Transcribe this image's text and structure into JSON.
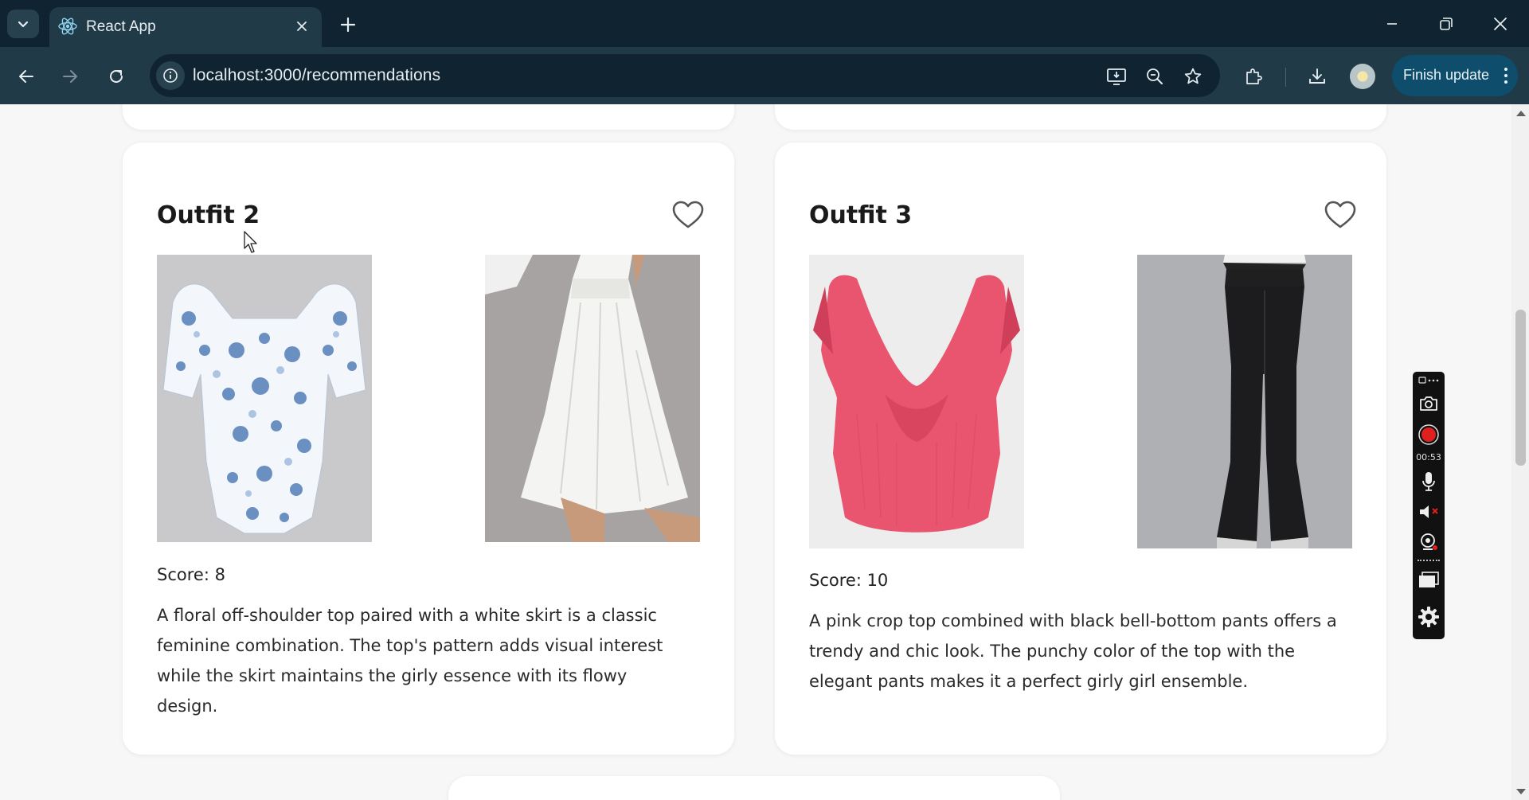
{
  "browser": {
    "tab_title": "React App",
    "url": "localhost:3000/recommendations",
    "finish_update_label": "Finish update"
  },
  "outfits": [
    {
      "title": "Outfit 2",
      "score": "Score: 8",
      "description": "A floral off-shoulder top paired with a white skirt is a classic feminine combination. The top's pattern adds visual interest while the skirt maintains the girly essence with its flowy design.",
      "items": [
        "floral-blue-top",
        "white-skirt"
      ]
    },
    {
      "title": "Outfit 3",
      "score": "Score: 10",
      "description": "A pink crop top combined with black bell-bottom pants offers a trendy and chic look. The punchy color of the top with the elegant pants makes it a perfect girly girl ensemble.",
      "items": [
        "pink-crop-top",
        "black-bell-bottom-pants"
      ]
    }
  ],
  "recorder": {
    "elapsed": "00:53"
  },
  "colors": {
    "chrome_dark": "#0f2430",
    "chrome_toolbar": "#213a47",
    "update_button": "#0e4d6c",
    "page_bg": "#f7f7f7",
    "card_bg": "#ffffff",
    "heart_stroke": "#555555",
    "record_red": "#e02020"
  }
}
